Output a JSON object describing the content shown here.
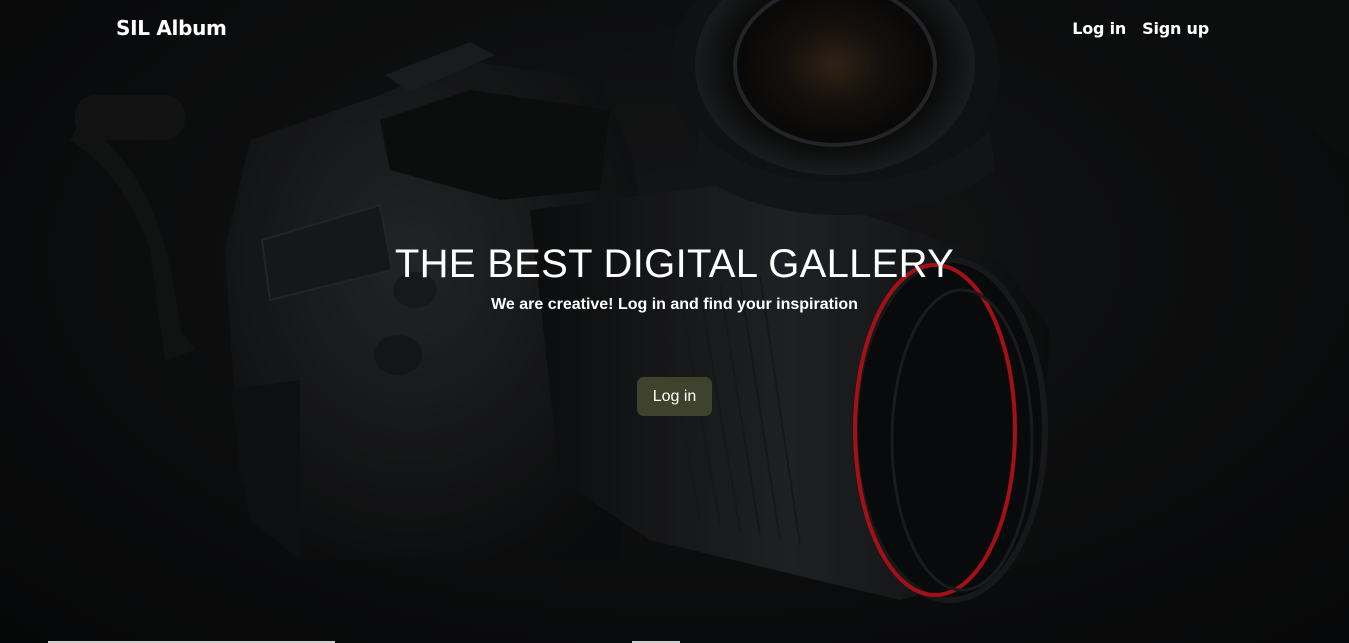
{
  "navbar": {
    "brand": "SIL Album",
    "links": [
      {
        "label": "Log in"
      },
      {
        "label": "Sign up"
      }
    ]
  },
  "hero": {
    "title": "THE BEST DIGITAL GALLERY",
    "subtitle": "We are creative! Log in and find your inspiration",
    "button_label": "Log in",
    "button_color": "#3f422c",
    "background_description_icon": "camera-photo-background"
  },
  "colors": {
    "text": "#ffffff",
    "background": "#0b0b0c",
    "lens_accent": "#c8141b"
  }
}
